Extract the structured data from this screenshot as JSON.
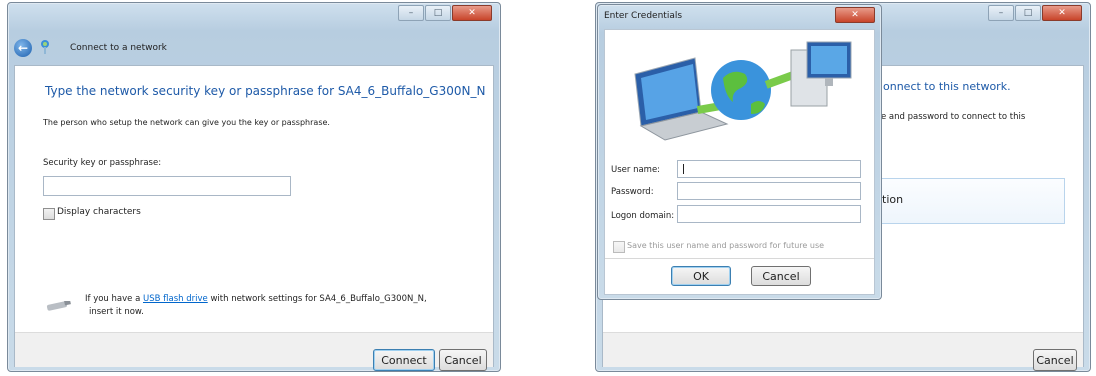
{
  "left": {
    "nav_title": "Connect to a network",
    "heading": "Type the network security key or passphrase for SA4_6_Buffalo_G300N_N",
    "info": "The person who setup the network can give you the key or passphrase.",
    "key_label": "Security key or passphrase:",
    "display_chars": "Display characters",
    "usb_pre": "If you have a",
    "usb_link": "USB flash drive",
    "usb_post": "with network settings for SA4_6_Buffalo_G300N_N,",
    "usb_line2": "insert it now.",
    "connect": "Connect",
    "cancel": "Cancel"
  },
  "right": {
    "dialog_title": "Enter Credentials",
    "user_label": "User name:",
    "pass_label": "Password:",
    "domain_label": "Logon domain:",
    "save_label": "Save this user name and password for future use",
    "ok": "OK",
    "cancel": "Cancel",
    "bg_heading": "onnect to this network.",
    "bg_sub": "e and password to connect to this",
    "bg_option": "tion",
    "bg_cancel": "Cancel"
  }
}
